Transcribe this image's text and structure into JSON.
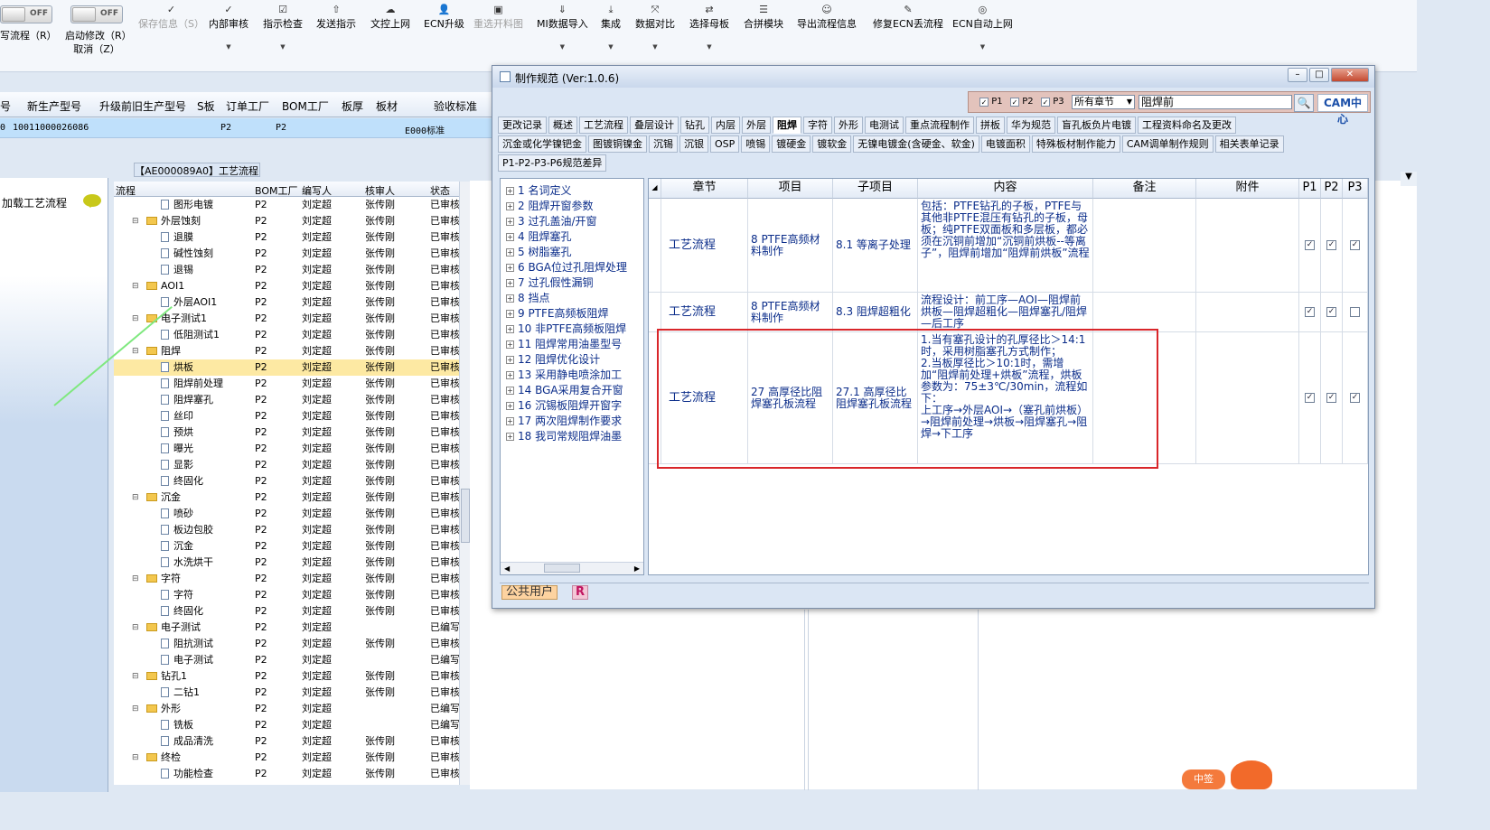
{
  "toolbar": {
    "left_switch": {
      "state": "OFF",
      "label": "写流程（R）"
    },
    "startup_switch": {
      "state": "OFF",
      "label": "启动修改（R）",
      "sublabel": "取消（Z）"
    },
    "items": [
      {
        "label": "保存信息（S）",
        "icon": "check-icon",
        "disabled": true
      },
      {
        "label": "内部审核",
        "icon": "check-icon"
      },
      {
        "label": "指示检查",
        "icon": "checkbox-icon"
      },
      {
        "label": "发送指示",
        "icon": "upload-icon"
      },
      {
        "label": "文控上网",
        "icon": "cloud-upload-icon"
      },
      {
        "label": "ECN升级",
        "icon": "user-icon"
      },
      {
        "label": "重选开料图",
        "icon": "image-icon",
        "disabled": true
      },
      {
        "label": "MI数据导入",
        "icon": "import-icon"
      },
      {
        "label": "集成",
        "icon": "download-icon"
      },
      {
        "label": "数据对比",
        "icon": "compare-icon"
      },
      {
        "label": "选择母板",
        "icon": "shuffle-icon"
      },
      {
        "label": "合拼模块",
        "icon": "list-icon"
      },
      {
        "label": "导出流程信息",
        "icon": "smile-icon"
      },
      {
        "label": "修复ECN丢流程",
        "icon": "wrench-icon"
      },
      {
        "label": "ECN自动上网",
        "icon": "globe-icon"
      }
    ]
  },
  "grid": {
    "headers": [
      "号",
      "新生产型号",
      "升级前旧生产型号",
      "S板",
      "订单工厂",
      "BOM工厂",
      "板厚",
      "板材",
      "验收标准"
    ],
    "row": [
      "0",
      "10011000026086",
      "",
      "",
      "P2",
      "P2",
      "",
      "",
      "E000标准"
    ]
  },
  "left_panel": {
    "load_label": "加载工艺流程"
  },
  "process_tree": {
    "title": "【AE000089A0】工艺流程",
    "headers": [
      "流程",
      "BOM工厂",
      "编写人",
      "核审人",
      "状态"
    ],
    "rows": [
      {
        "name": "图形电镀",
        "level": 2,
        "type": "doc",
        "bom": "P2",
        "writer": "刘定超",
        "reviewer": "张传刚",
        "status": "已审核"
      },
      {
        "name": "外层蚀刻",
        "level": 1,
        "type": "folder",
        "bom": "P2",
        "writer": "刘定超",
        "reviewer": "张传刚",
        "status": "已审核"
      },
      {
        "name": "退膜",
        "level": 2,
        "type": "doc",
        "bom": "P2",
        "writer": "刘定超",
        "reviewer": "张传刚",
        "status": "已审核"
      },
      {
        "name": "碱性蚀刻",
        "level": 2,
        "type": "doc",
        "bom": "P2",
        "writer": "刘定超",
        "reviewer": "张传刚",
        "status": "已审核"
      },
      {
        "name": "退锡",
        "level": 2,
        "type": "doc",
        "bom": "P2",
        "writer": "刘定超",
        "reviewer": "张传刚",
        "status": "已审核"
      },
      {
        "name": "AOI1",
        "level": 1,
        "type": "folder",
        "bom": "P2",
        "writer": "刘定超",
        "reviewer": "张传刚",
        "status": "已审核"
      },
      {
        "name": "外层AOI1",
        "level": 2,
        "type": "doc",
        "bom": "P2",
        "writer": "刘定超",
        "reviewer": "张传刚",
        "status": "已审核"
      },
      {
        "name": "电子测试1",
        "level": 1,
        "type": "folder",
        "bom": "P2",
        "writer": "刘定超",
        "reviewer": "张传刚",
        "status": "已审核"
      },
      {
        "name": "低阻测试1",
        "level": 2,
        "type": "doc",
        "bom": "P2",
        "writer": "刘定超",
        "reviewer": "张传刚",
        "status": "已审核"
      },
      {
        "name": "阻焊",
        "level": 1,
        "type": "folder",
        "bom": "P2",
        "writer": "刘定超",
        "reviewer": "张传刚",
        "status": "已审核"
      },
      {
        "name": "烘板",
        "level": 2,
        "type": "doc",
        "bom": "P2",
        "writer": "刘定超",
        "reviewer": "张传刚",
        "status": "已审核",
        "selected": true
      },
      {
        "name": "阻焊前处理",
        "level": 2,
        "type": "doc",
        "bom": "P2",
        "writer": "刘定超",
        "reviewer": "张传刚",
        "status": "已审核"
      },
      {
        "name": "阻焊塞孔",
        "level": 2,
        "type": "doc",
        "bom": "P2",
        "writer": "刘定超",
        "reviewer": "张传刚",
        "status": "已审核"
      },
      {
        "name": "丝印",
        "level": 2,
        "type": "doc",
        "bom": "P2",
        "writer": "刘定超",
        "reviewer": "张传刚",
        "status": "已审核"
      },
      {
        "name": "预烘",
        "level": 2,
        "type": "doc",
        "bom": "P2",
        "writer": "刘定超",
        "reviewer": "张传刚",
        "status": "已审核"
      },
      {
        "name": "曝光",
        "level": 2,
        "type": "doc",
        "bom": "P2",
        "writer": "刘定超",
        "reviewer": "张传刚",
        "status": "已审核"
      },
      {
        "name": "显影",
        "level": 2,
        "type": "doc",
        "bom": "P2",
        "writer": "刘定超",
        "reviewer": "张传刚",
        "status": "已审核"
      },
      {
        "name": "终固化",
        "level": 2,
        "type": "doc",
        "bom": "P2",
        "writer": "刘定超",
        "reviewer": "张传刚",
        "status": "已审核"
      },
      {
        "name": "沉金",
        "level": 1,
        "type": "folder",
        "bom": "P2",
        "writer": "刘定超",
        "reviewer": "张传刚",
        "status": "已审核"
      },
      {
        "name": "喷砂",
        "level": 2,
        "type": "doc",
        "bom": "P2",
        "writer": "刘定超",
        "reviewer": "张传刚",
        "status": "已审核"
      },
      {
        "name": "板边包胶",
        "level": 2,
        "type": "doc",
        "bom": "P2",
        "writer": "刘定超",
        "reviewer": "张传刚",
        "status": "已审核"
      },
      {
        "name": "沉金",
        "level": 2,
        "type": "doc",
        "bom": "P2",
        "writer": "刘定超",
        "reviewer": "张传刚",
        "status": "已审核"
      },
      {
        "name": "水洗烘干",
        "level": 2,
        "type": "doc",
        "bom": "P2",
        "writer": "刘定超",
        "reviewer": "张传刚",
        "status": "已审核"
      },
      {
        "name": "字符",
        "level": 1,
        "type": "folder",
        "bom": "P2",
        "writer": "刘定超",
        "reviewer": "张传刚",
        "status": "已审核"
      },
      {
        "name": "字符",
        "level": 2,
        "type": "doc",
        "bom": "P2",
        "writer": "刘定超",
        "reviewer": "张传刚",
        "status": "已审核"
      },
      {
        "name": "终固化",
        "level": 2,
        "type": "doc",
        "bom": "P2",
        "writer": "刘定超",
        "reviewer": "张传刚",
        "status": "已审核"
      },
      {
        "name": "电子测试",
        "level": 1,
        "type": "folder",
        "bom": "P2",
        "writer": "刘定超",
        "reviewer": "",
        "status": "已编写"
      },
      {
        "name": "阻抗测试",
        "level": 2,
        "type": "doc",
        "bom": "P2",
        "writer": "刘定超",
        "reviewer": "张传刚",
        "status": "已审核"
      },
      {
        "name": "电子测试",
        "level": 2,
        "type": "doc",
        "bom": "P2",
        "writer": "刘定超",
        "reviewer": "",
        "status": "已编写"
      },
      {
        "name": "钻孔1",
        "level": 1,
        "type": "folder",
        "bom": "P2",
        "writer": "刘定超",
        "reviewer": "张传刚",
        "status": "已审核"
      },
      {
        "name": "二钻1",
        "level": 2,
        "type": "doc",
        "bom": "P2",
        "writer": "刘定超",
        "reviewer": "张传刚",
        "status": "已审核"
      },
      {
        "name": "外形",
        "level": 1,
        "type": "folder",
        "bom": "P2",
        "writer": "刘定超",
        "reviewer": "",
        "status": "已编写"
      },
      {
        "name": "铣板",
        "level": 2,
        "type": "doc",
        "bom": "P2",
        "writer": "刘定超",
        "reviewer": "",
        "status": "已编写"
      },
      {
        "name": "成品清洗",
        "level": 2,
        "type": "doc",
        "bom": "P2",
        "writer": "刘定超",
        "reviewer": "张传刚",
        "status": "已审核"
      },
      {
        "name": "终检",
        "level": 1,
        "type": "folder",
        "bom": "P2",
        "writer": "刘定超",
        "reviewer": "张传刚",
        "status": "已审核"
      },
      {
        "name": "功能检查",
        "level": 2,
        "type": "doc",
        "bom": "P2",
        "writer": "刘定超",
        "reviewer": "张传刚",
        "status": "已审核"
      }
    ]
  },
  "dialog": {
    "title": "制作规范 (Ver:1.0.6)",
    "search": {
      "p_labels": [
        "P1",
        "P2",
        "P3"
      ],
      "chapter_select": "所有章节",
      "query": "阻焊前",
      "logo": "CAM中心"
    },
    "tabs_row1": [
      "更改记录",
      "概述",
      "工艺流程",
      "叠层设计",
      "钻孔",
      "内层",
      "外层",
      "阻焊",
      "字符",
      "外形",
      "电测试",
      "重点流程制作",
      "拼板",
      "华为规范",
      "盲孔板负片电镀",
      "工程资料命名及更改"
    ],
    "tabs_row2": [
      "沉金或化学镍钯金",
      "图镀铜镍金",
      "沉锡",
      "沉银",
      "OSP",
      "喷锡",
      "镀硬金",
      "镀软金",
      "无镍电镀金(含硬金、软金)",
      "电镀面积",
      "特殊板材制作能力",
      "CAM调单制作规则",
      "相关表单记录"
    ],
    "tabs_row3": [
      "P1-P2-P3-P6规范差异"
    ],
    "active_tab": "阻焊",
    "chapters": [
      "1 名词定义",
      "2 阻焊开窗参数",
      "3 过孔盖油/开窗",
      "4 阻焊塞孔",
      "5 树脂塞孔",
      "6 BGA位过孔阻焊处理",
      "7 过孔假性漏铜",
      "8 挡点",
      "9 PTFE高频板阻焊",
      "10 非PTFE高频板阻焊",
      "11 阻焊常用油墨型号",
      "12 阻焊优化设计",
      "13 采用静电喷涂加工",
      "14 BGA采用复合开窗",
      "16 沉锡板阻焊开窗字",
      "17 两次阻焊制作要求",
      "18 我司常规阻焊油墨"
    ],
    "table": {
      "headers": [
        "章节",
        "项目",
        "子项目",
        "内容",
        "备注",
        "附件",
        "P1",
        "P2",
        "P3"
      ],
      "rows": [
        {
          "chapter": "工艺流程",
          "item": "8 PTFE高频材料制作",
          "subitem": "8.1 等离子处理",
          "content": "包括：PTFE钻孔的子板，PTFE与其他非PTFE混压有钻孔的子板，母板；纯PTFE双面板和多层板，都必须在沉铜前增加“沉铜前烘板--等离子”，阻焊前增加“阻焊前烘板”流程",
          "note": "",
          "attach": "",
          "p1": true,
          "p2": true,
          "p3": true
        },
        {
          "chapter": "工艺流程",
          "item": "8 PTFE高频材料制作",
          "subitem": "8.3 阻焊超粗化",
          "content": "流程设计：前工序—AOI—阻焊前烘板—阻焊超粗化—阻焊塞孔/阻焊—后工序",
          "note": "",
          "attach": "",
          "p1": true,
          "p2": true,
          "p3": false
        },
        {
          "chapter": "工艺流程",
          "item": "27 高厚径比阻焊塞孔板流程",
          "subitem": "27.1 高厚径比阻焊塞孔板流程",
          "content": "1.当有塞孔设计的孔厚径比＞14:1时，采用树脂塞孔方式制作；\n2.当板厚径比＞10:1时，需增加“阻焊前处理+烘板”流程，烘板参数为：75±3℃/30min，流程如下：\n上工序→外层AOI→（塞孔前烘板）→阻焊前处理→烘板→阻焊塞孔→阻焊→下工序",
          "note": "",
          "attach": "",
          "p1": true,
          "p2": true,
          "p3": true
        }
      ]
    },
    "status_user": "公共用户",
    "status_badge": "R"
  },
  "mascot_text": "中签"
}
